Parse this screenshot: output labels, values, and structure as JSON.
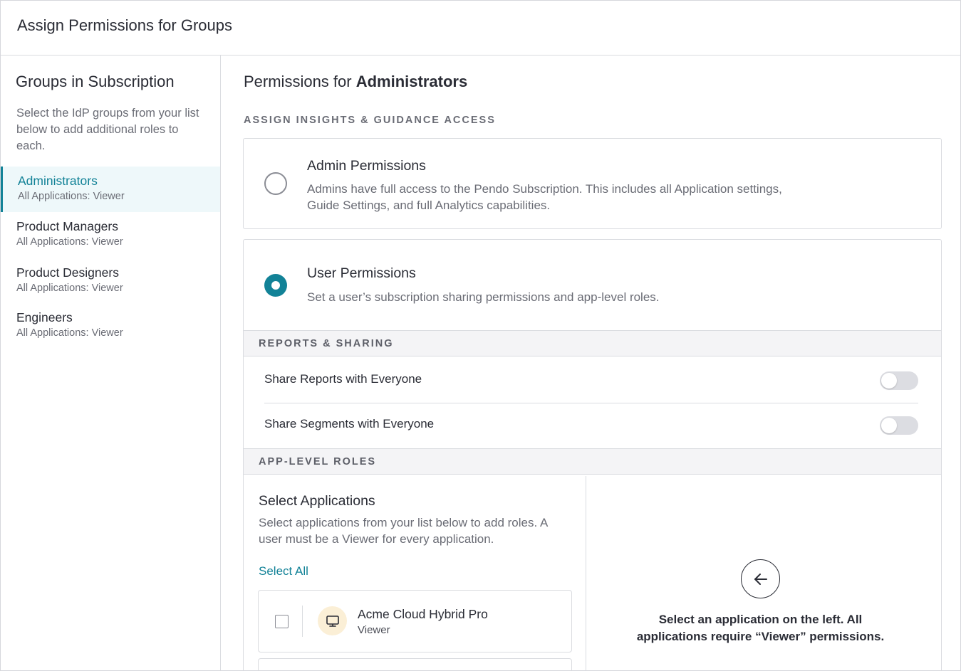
{
  "header": {
    "title": "Assign Permissions for Groups"
  },
  "sidebar": {
    "title": "Groups in Subscription",
    "description": "Select the IdP groups from your list below to add additional roles to each.",
    "groups": [
      {
        "name": "Administrators",
        "sub": "All Applications: Viewer",
        "active": true
      },
      {
        "name": "Product Managers",
        "sub": "All Applications: Viewer",
        "active": false
      },
      {
        "name": "Product Designers",
        "sub": "All Applications: Viewer",
        "active": false
      },
      {
        "name": "Engineers",
        "sub": "All Applications: Viewer",
        "active": false
      }
    ]
  },
  "main": {
    "title_prefix": "Permissions for",
    "title_group": "Administrators",
    "section_label": "ASSIGN INSIGHTS & GUIDANCE ACCESS",
    "admin": {
      "title": "Admin Permissions",
      "description": "Admins have full access to the Pendo Subscription. This includes all Application settings, Guide Settings, and full Analytics capabilities.",
      "selected": false
    },
    "user": {
      "title": "User Permissions",
      "description": "Set a user’s subscription sharing permissions and app-level roles.",
      "selected": true
    },
    "reports": {
      "header": "REPORTS & SHARING",
      "toggles": [
        {
          "label": "Share Reports with Everyone",
          "on": false
        },
        {
          "label": "Share Segments with Everyone",
          "on": false
        }
      ]
    },
    "app_roles": {
      "header": "APP-LEVEL ROLES",
      "title": "Select Applications",
      "description": "Select applications from your list below to add roles. A user must be a Viewer for every application.",
      "select_all": "Select All",
      "apps": [
        {
          "name": "Acme Cloud Hybrid Pro",
          "role": "Viewer",
          "icon": "monitor-icon",
          "icon_bg": "#fbefd6"
        }
      ],
      "empty_message": "Select an application on the left. All applications require “Viewer” permissions."
    }
  },
  "colors": {
    "accent": "#128297",
    "text": "#2a2c35",
    "muted": "#6a6c75",
    "border": "#dadce0"
  }
}
